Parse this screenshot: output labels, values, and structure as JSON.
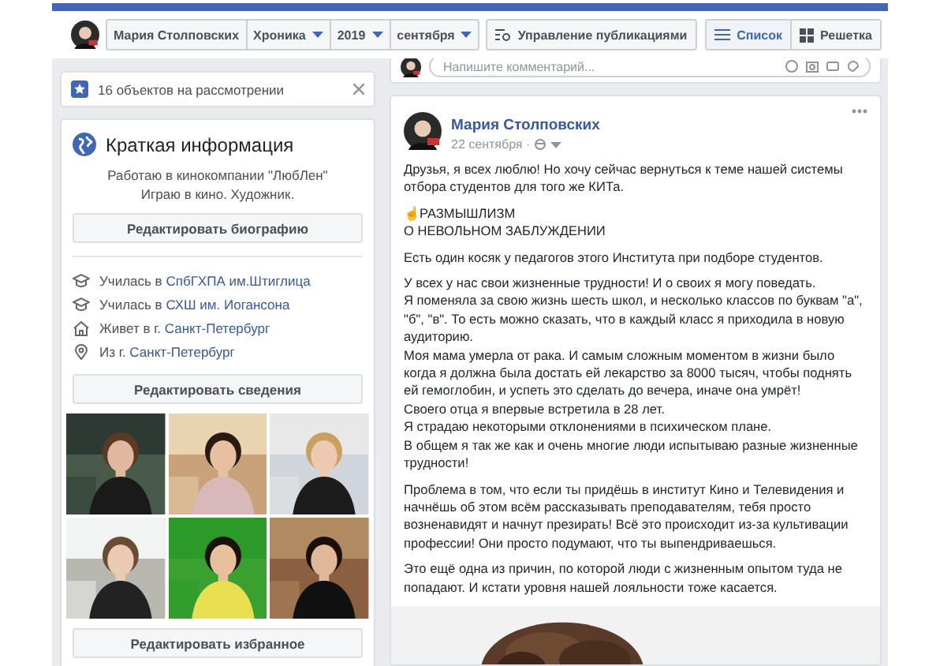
{
  "header": {
    "crumbs": [
      {
        "label": "Мария Столповских",
        "kind": "name"
      },
      {
        "label": "Хроника",
        "kind": "dropdown"
      },
      {
        "label": "2019",
        "kind": "dropdown"
      },
      {
        "label": "сентября",
        "kind": "dropdown"
      }
    ],
    "manage_button": "Управление публикациями",
    "views": [
      {
        "label": "Список",
        "kind": "list",
        "selected": true
      },
      {
        "label": "Решетка",
        "kind": "grid",
        "selected": false
      }
    ]
  },
  "review_notice": {
    "text": "16 объектов на рассмотрении"
  },
  "intro": {
    "title": "Краткая информация",
    "bio": [
      "Работаю в кинокомпании \"ЛюбЛен\"",
      "Играю в кино. Художник."
    ],
    "edit_bio_button": "Редактировать биографию",
    "details": [
      {
        "kind": "study",
        "prefix": "Училась в",
        "link": "СпбГХПА им.Штиглица"
      },
      {
        "kind": "study",
        "prefix": "Училась в",
        "link": "СХШ им. Иогансона"
      },
      {
        "kind": "home",
        "prefix": "Живет в г.",
        "link": "Санкт-Петербург"
      },
      {
        "kind": "place",
        "prefix": "Из г.",
        "link": "Санкт-Петербург"
      }
    ],
    "edit_details_button": "Редактировать сведения",
    "photos": [
      {
        "kind": "picture"
      },
      {
        "kind": "picture"
      },
      {
        "kind": "picture"
      },
      {
        "kind": "picture"
      },
      {
        "kind": "picture"
      },
      {
        "kind": "picture"
      }
    ],
    "edit_featured_button": "Редактировать избранное"
  },
  "comment_box": {
    "placeholder": "Напишите комментарий..."
  },
  "post": {
    "author": "Мария Столповских",
    "date": "22 сентября ·",
    "paragraphs": [
      [
        "Друзья, я всех люблю! Но хочу сейчас вернуться к теме нашей системы отбора студентов для того же КИТа."
      ],
      [
        "☝РАЗМЫШЛИЗМ",
        "О НЕВОЛЬНОМ ЗАБЛУЖДЕНИИ"
      ],
      [
        "Есть один косяк у педагогов этого Института при подборе студентов."
      ],
      [
        "У всех у нас свои жизненные трудности! И о своих я могу поведать.",
        "Я поменяла за свою жизнь шесть школ, и несколько классов по буквам \"а\", \"б\", \"в\". То есть можно сказать, что в каждый класс я приходила в новую аудиторию.",
        "Моя мама умерла от рака. И самым сложным моментом в жизни было когда я должна была достать ей лекарство за 8000 тысяч, чтобы поднять ей гемоглобин, и успеть это сделать до вечера, иначе она умрёт!",
        "Своего отца я впервые встретила в 28 лет.",
        "Я страдаю некоторыми отклонениями в психическом плане.",
        "В общем я так же как и очень многие люди испытываю разные жизненные трудности!"
      ],
      [
        "Проблема в том, что если ты придёшь в институт Кино и Телевидения и начнёшь об этом всём рассказывать преподавателям, тебя просто возненавидят и начнут презирать! Всё это происходит из-за культивации профессии! Они просто подумают, что ты выпендриваешься."
      ],
      [
        "Это ещё одна из причин, по которой люди с жизненным опытом туда не попадают. И кстати уровня нашей лояльности тоже касается."
      ]
    ],
    "image": {
      "kind": "picture"
    }
  }
}
